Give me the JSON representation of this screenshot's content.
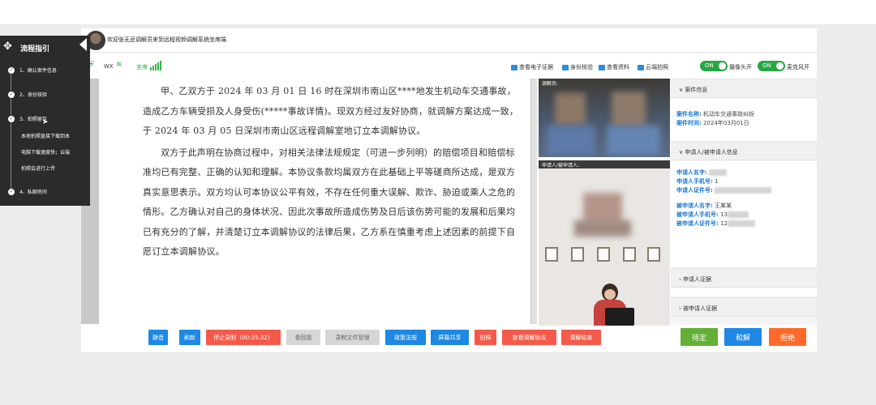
{
  "header": {
    "welcome_text": "欢迎张无忌调解员来到远程视频调解系统坐席端"
  },
  "status": {
    "wx_label": "WX",
    "network_label": "坐席"
  },
  "toolbar": {
    "items": [
      "查看电子证据",
      "身份核验",
      "查看资料",
      "云端拍照"
    ],
    "camera_toggle": "ON",
    "camera_label": "摄像头开",
    "mic_toggle": "ON",
    "mic_label": "麦克风开"
  },
  "document": {
    "paragraphs": [
      "甲、乙双方于 2024 年 03 月 01 日 16 时在深圳市南山区****地发生机动车交通事故，造成乙方车辆受损及人身受伤(*****事故详情)。现双方经过友好协商，就调解方案达成一致，于 2024 年 03 月 05 日深圳市南山区远程调解室地订立本调解协议。",
      "双方于此声明在协商过程中，对相关法律法规规定（可进一步列明）的赔偿项目和赔偿标准均已有完整、正确的认知和理解。本协议条款均属双方在此基础上平等磋商所达成，是双方真实意思表示。双方均认可本协议公平有效，不存在任何重大误解、欺诈、胁迫或乘人之危的情形。乙方确认对自己的身体状况、因此次事故所造成伤势及日后该伤势可能的发展和后果均已有充分的了解，并清楚订立本调解协议的法律后果，乙方系在慎重考虑上述因素的前提下自愿订立本调解协议。"
    ]
  },
  "video": {
    "mediator_label": "调解员:",
    "applicant_label": "申请人/被申请人:"
  },
  "sidebar": {
    "case_section": "案件信息",
    "case_name_key": "案件名称:",
    "case_name_val": "机动车交通事故纠纷",
    "case_time_key": "案件时间:",
    "case_time_val": "2024年03月01日",
    "party_section": "申请人/被申请人信息",
    "applicant_name_key": "申请人名字:",
    "applicant_phone_key": "申请人手机号:",
    "applicant_phone_val": "1",
    "applicant_id_key": "申请人证件号:",
    "respondent_name_key": "被申请人名字:",
    "respondent_name_val": "王某某",
    "respondent_phone_key": "被申请人手机号:",
    "respondent_phone_val": "13",
    "respondent_id_key": "被申请人证件号:",
    "respondent_id_val": "12",
    "applicant_evidence": "申请人证据",
    "respondent_evidence": "被申请人证据"
  },
  "actions": {
    "mute": "静音",
    "refresh": "刷新",
    "stop_record": "停止录制（00:35:32）",
    "playback": "看回放",
    "record_files": "录制文件管理",
    "policy": "政策法规",
    "share_screen": "屏幕共享",
    "photo": "拍照",
    "view_agreement": "查看调解协议",
    "end_mediation": "调解结束",
    "pending": "待定",
    "settle": "和解",
    "reject": "拒绝"
  },
  "guide": {
    "title": "流程指引",
    "step1": "1、确认案件信息",
    "step2": "2、身份核验",
    "step3": "3、拍照留存",
    "note1": "本地拍照直接下载到本",
    "note2": "电脑下载速度快；云端",
    "note3": "拍照会进行上传",
    "step4": "4、私聊房间"
  },
  "colors": {
    "accent_blue": "#1e88e5",
    "accent_red": "#f45a4a",
    "green": "#27a844",
    "orange": "#ff6a2a",
    "guide_bg": "#2b2b2b"
  }
}
